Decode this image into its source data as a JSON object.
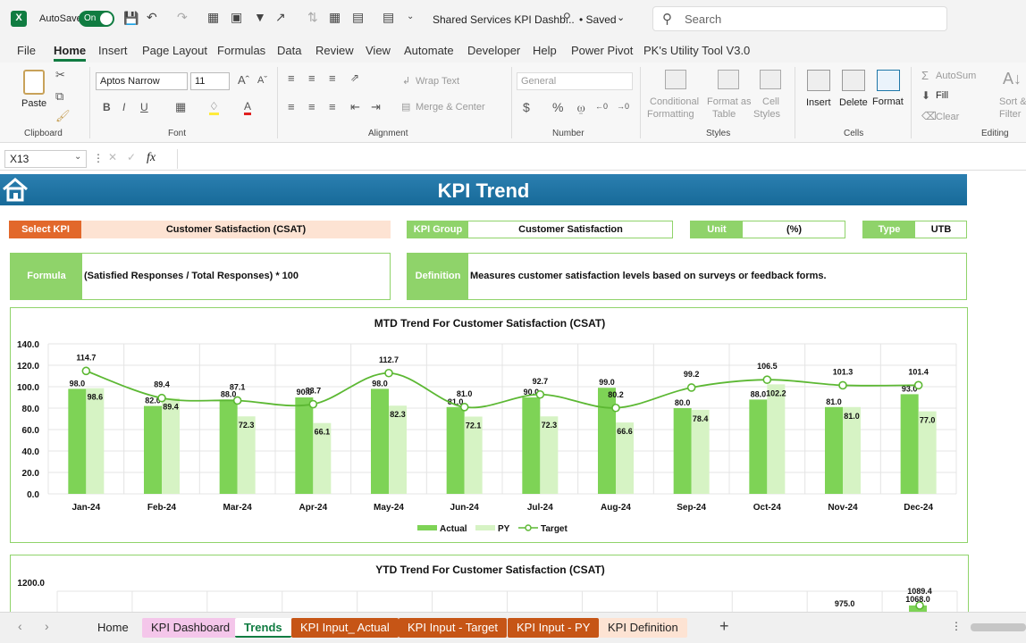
{
  "titlebar": {
    "autosave": "AutoSave",
    "toggle": "On",
    "filename": "Shared Services KPI Dashb...",
    "saved": "• Saved",
    "search_placeholder": "Search"
  },
  "menu": [
    "File",
    "Home",
    "Insert",
    "Page Layout",
    "Formulas",
    "Data",
    "Review",
    "View",
    "Automate",
    "Developer",
    "Help",
    "Power Pivot",
    "PK's Utility Tool V3.0"
  ],
  "ribbon": {
    "paste": "Paste",
    "clipboard": "Clipboard",
    "font_name": "Aptos Narrow",
    "font_size": "11",
    "font": "Font",
    "wrap": "Wrap Text",
    "merge": "Merge & Center",
    "alignment": "Alignment",
    "number_format": "General",
    "number": "Number",
    "conditional": [
      "Conditional",
      "Formatting"
    ],
    "format_table": [
      "Format as",
      "Table"
    ],
    "cell_styles": [
      "Cell",
      "Styles"
    ],
    "styles": "Styles",
    "insert": "Insert",
    "delete": "Delete",
    "format": "Format",
    "cells": "Cells",
    "autosum": "AutoSum",
    "fill": "Fill",
    "clear": "Clear",
    "sort": [
      "Sort &",
      "Filter"
    ],
    "editing": "Editing"
  },
  "formula_bar": {
    "cell_ref": "X13",
    "fx": "fx",
    "content": ""
  },
  "dashboard": {
    "title": "KPI Trend",
    "select_kpi_label": "Select KPI",
    "select_kpi_value": "Customer Satisfaction (CSAT)",
    "kpi_group_label": "KPI Group",
    "kpi_group_value": "Customer Satisfaction",
    "unit_label": "Unit",
    "unit_value": "(%)",
    "type_label": "Type",
    "type_value": "UTB",
    "formula_label": "Formula",
    "formula_value": "(Satisfied Responses / Total Responses) * 100",
    "definition_label": "Definition",
    "definition_value": "Measures customer satisfaction levels based on surveys or feedback forms."
  },
  "colors": {
    "actual": "#7ed356",
    "py": "#d6f3c4",
    "target": "#5cb833",
    "orange": "#e2682b",
    "green": "#8fd36a",
    "banner": "#1f77a8"
  },
  "chart_data": [
    {
      "type": "bar",
      "title": "MTD Trend For Customer Satisfaction (CSAT)",
      "categories": [
        "Jan-24",
        "Feb-24",
        "Mar-24",
        "Apr-24",
        "May-24",
        "Jun-24",
        "Jul-24",
        "Aug-24",
        "Sep-24",
        "Oct-24",
        "Nov-24",
        "Dec-24"
      ],
      "series": [
        {
          "name": "Actual",
          "values": [
            98.0,
            82.0,
            88.0,
            90.0,
            98.0,
            81.0,
            90.0,
            99.0,
            80.0,
            88.0,
            81.0,
            93.0
          ],
          "labels": [
            "98.0",
            "82.0",
            "88.0",
            "90.0",
            "98.0",
            "81.0",
            "90.0",
            "99.0",
            "80.0",
            "88.0",
            "81.0",
            "93.0"
          ]
        },
        {
          "name": "PY",
          "values": [
            98.6,
            89.4,
            72.3,
            66.1,
            82.3,
            72.1,
            72.3,
            66.6,
            78.4,
            102.2,
            81.0,
            77.0
          ],
          "labels": [
            "98.6",
            "89.4",
            "72.3",
            "66.1",
            "82.3",
            "72.1",
            "72.3",
            "66.6",
            "78.4",
            "102.2",
            "81.0",
            "77.0"
          ]
        },
        {
          "name": "Target",
          "type": "line",
          "values": [
            114.7,
            89.4,
            87.1,
            83.7,
            112.7,
            81.0,
            92.7,
            80.2,
            99.2,
            106.5,
            101.3,
            101.4
          ],
          "labels": [
            "114.7",
            "89.4",
            "87.1",
            "83.7",
            "112.7",
            "81.0",
            "92.7",
            "80.2",
            "99.2",
            "106.5",
            "101.3",
            "101.4"
          ]
        }
      ],
      "ylim": [
        0,
        140
      ],
      "yticks": [
        "0.0",
        "20.0",
        "40.0",
        "60.0",
        "80.0",
        "100.0",
        "120.0",
        "140.0"
      ],
      "legend": "bottom",
      "grid": true
    },
    {
      "type": "bar",
      "title": "YTD Trend For Customer Satisfaction (CSAT)",
      "yticks_visible": [
        "1200.0"
      ],
      "visible_labels": [
        "1089.4",
        "1068.0",
        "975.0"
      ]
    }
  ],
  "sheet_tabs": [
    {
      "label": "Home",
      "bg": "#f0f0f0",
      "fg": "#222"
    },
    {
      "label": "KPI Dashboard",
      "bg": "#f4c6ea",
      "fg": "#222"
    },
    {
      "label": "Trends",
      "bg": "#ffffff",
      "fg": "#107c41"
    },
    {
      "label": "KPI Input_ Actual",
      "bg": "#c65516",
      "fg": "#ffffff"
    },
    {
      "label": "KPI Input - Target",
      "bg": "#c65516",
      "fg": "#ffffff"
    },
    {
      "label": "KPI Input - PY",
      "bg": "#c65516",
      "fg": "#ffffff"
    },
    {
      "label": "KPI Definition",
      "bg": "#fde3d3",
      "fg": "#222"
    }
  ]
}
